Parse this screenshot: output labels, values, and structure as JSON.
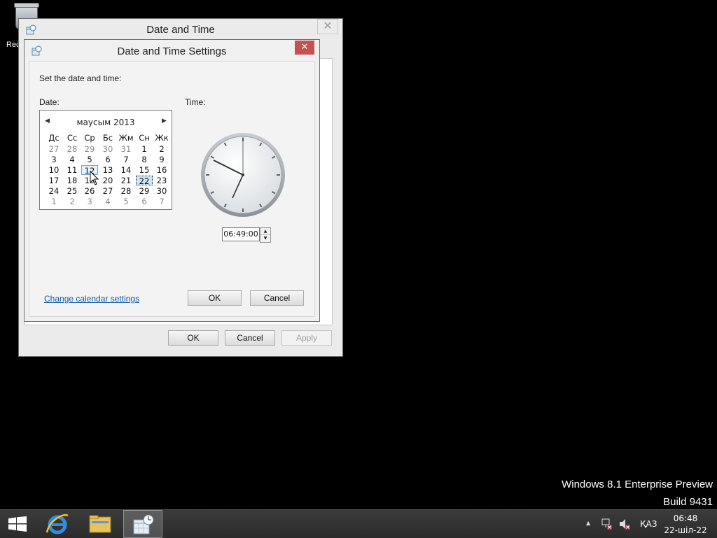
{
  "desktop": {
    "recycle_label": "Rec",
    "watermark_line1": "Windows 8.1 Enterprise Preview",
    "watermark_line2": "Build 9431"
  },
  "outer_window": {
    "title": "Date and Time",
    "close": "✕",
    "buttons": {
      "ok": "OK",
      "cancel": "Cancel",
      "apply": "Apply"
    }
  },
  "inner_dialog": {
    "title": "Date and Time Settings",
    "close": "✕",
    "instruction": "Set the date and time:",
    "date_label": "Date:",
    "time_label": "Time:",
    "calendar": {
      "month": "маусым 2013",
      "prev_arrow": "◀",
      "next_arrow": "▶",
      "weekdays": [
        "Дс",
        "Сс",
        "Ср",
        "Бс",
        "Жм",
        "Сн",
        "Жк"
      ],
      "weeks": [
        [
          "27",
          "28",
          "29",
          "30",
          "31",
          "1",
          "2"
        ],
        [
          "3",
          "4",
          "5",
          "6",
          "7",
          "8",
          "9"
        ],
        [
          "10",
          "11",
          "12",
          "13",
          "14",
          "15",
          "16"
        ],
        [
          "17",
          "18",
          "19",
          "20",
          "21",
          "22",
          "23"
        ],
        [
          "24",
          "25",
          "26",
          "27",
          "28",
          "29",
          "30"
        ],
        [
          "1",
          "2",
          "3",
          "4",
          "5",
          "6",
          "7"
        ]
      ],
      "today": "12",
      "selected": "22"
    },
    "time_value": "06:49:00",
    "spinner_up": "▲",
    "spinner_down": "▼",
    "change_calendar_link": "Change calendar settings",
    "buttons": {
      "ok": "OK",
      "cancel": "Cancel"
    }
  },
  "taskbar": {
    "items": [
      "start-icon",
      "internet-explorer-icon",
      "file-explorer-icon",
      "date-time-control-panel-icon"
    ],
    "tray": {
      "expand": "▲",
      "language": "ҚАЗ",
      "time": "06:48",
      "date": "22-шіл-22"
    }
  },
  "colors": {
    "close_red": "#c75050",
    "link_blue": "#0b5aa5",
    "selected_day": "#cde6f7"
  }
}
